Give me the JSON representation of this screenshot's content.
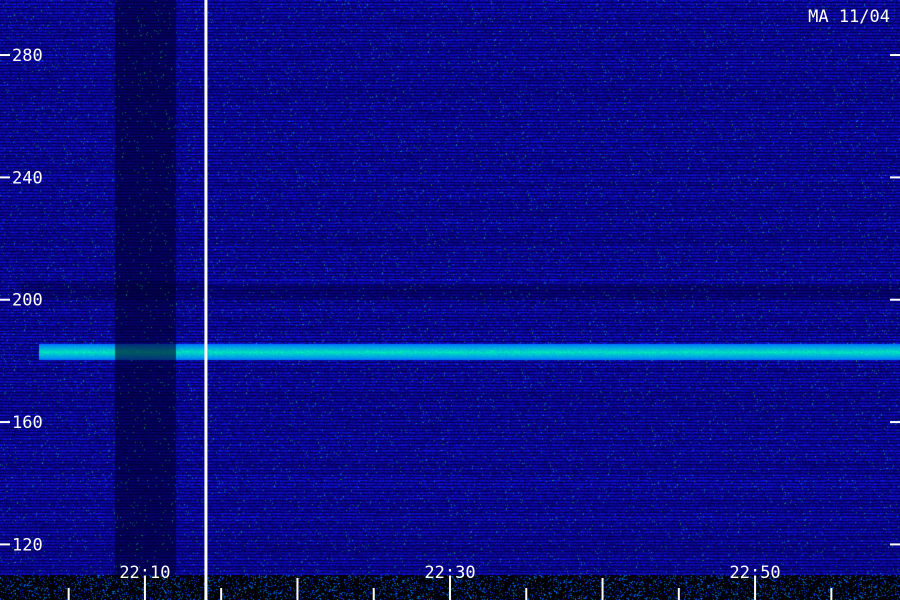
{
  "chart_data": {
    "type": "heatmap",
    "title": "MA 11/04",
    "xlabel": "",
    "ylabel": "",
    "y_ticks": [
      "280",
      "240",
      "200",
      "160",
      "120"
    ],
    "y_tick_values": [
      280,
      240,
      200,
      160,
      120
    ],
    "ylim": [
      110,
      298
    ],
    "x_ticks": [
      "22:10",
      "22:30",
      "22:50"
    ],
    "x_tick_minutes": [
      10,
      30,
      50
    ],
    "xlim_minutes": [
      0.5,
      59.5
    ],
    "features": [
      {
        "name": "carrier",
        "y": 183,
        "x_start_minutes": 3,
        "x_end_minutes": 59.5
      },
      {
        "name": "faint-band",
        "y": 206,
        "x_start_minutes": 14,
        "x_end_minutes": 59.5
      },
      {
        "name": "dark-column",
        "x_start_minutes": 8,
        "x_end_minutes": 12
      },
      {
        "name": "marker-line",
        "x_minutes": 14
      }
    ],
    "colormap": [
      "#05052a",
      "#1a1a9a",
      "#3a3aff",
      "#00ffaa"
    ],
    "grid": false
  }
}
